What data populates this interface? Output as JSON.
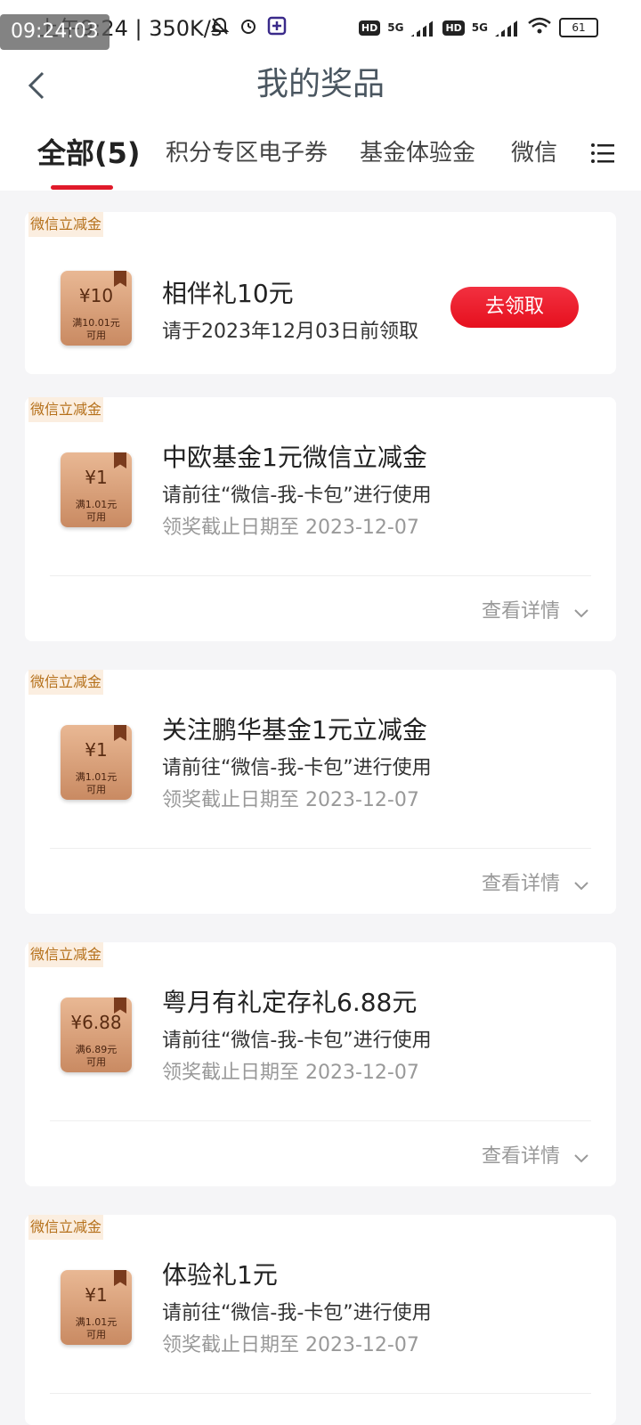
{
  "status_bar": {
    "time_overlay": "09:24:03",
    "left_text": "上午9:24 | 350K/s",
    "battery": "61"
  },
  "header": {
    "title": "我的奖品"
  },
  "tabs": [
    {
      "label": "全部(5)"
    },
    {
      "label": "积分专区电子券"
    },
    {
      "label": "基金体验金"
    },
    {
      "label": "微信"
    }
  ],
  "prizes": [
    {
      "tag": "微信立减金",
      "coupon_amount": "¥10",
      "coupon_condition": "满10.01元\n可用",
      "title": "相伴礼10元",
      "line": "请于2023年12月03日前领取",
      "button": "去领取"
    },
    {
      "tag": "微信立减金",
      "coupon_amount": "¥1",
      "coupon_condition": "满1.01元\n可用",
      "title": "中欧基金1元微信立减金",
      "line": "请前往“微信-我-卡包”进行使用",
      "deadline": "领奖截止日期至 2023-12-07",
      "detail": "查看详情"
    },
    {
      "tag": "微信立减金",
      "coupon_amount": "¥1",
      "coupon_condition": "满1.01元\n可用",
      "title": "关注鹏华基金1元立减金",
      "line": "请前往“微信-我-卡包”进行使用",
      "deadline": "领奖截止日期至 2023-12-07",
      "detail": "查看详情"
    },
    {
      "tag": "微信立减金",
      "coupon_amount": "¥6.88",
      "coupon_condition": "满6.89元\n可用",
      "title": "粤月有礼定存礼6.88元",
      "line": "请前往“微信-我-卡包”进行使用",
      "deadline": "领奖截止日期至 2023-12-07",
      "detail": "查看详情"
    },
    {
      "tag": "微信立减金",
      "coupon_amount": "¥1",
      "coupon_condition": "满1.01元\n可用",
      "title": "体验礼1元",
      "line": "请前往“微信-我-卡包”进行使用",
      "deadline": "领奖截止日期至 2023-12-07"
    }
  ]
}
